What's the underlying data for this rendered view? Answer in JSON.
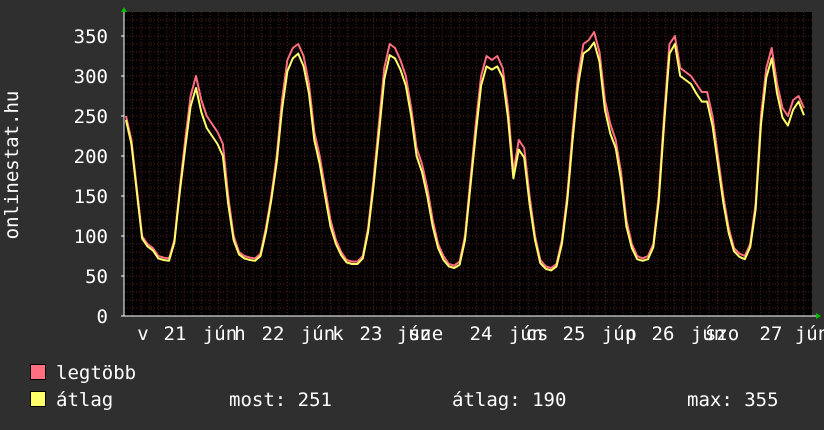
{
  "colors": {
    "background": "#2f2f2f",
    "plot_background": "#000000",
    "grid": "#5a1e1e",
    "axis": "#ffffff",
    "max_series": "#ff6f7f",
    "avg_series": "#ffff6a"
  },
  "legend": {
    "max_label": "legtöbb",
    "avg_label": "átlag"
  },
  "stats": {
    "current": "most: 251",
    "average": "átlag: 190",
    "maximum": "max: 355"
  },
  "chart_data": {
    "type": "line",
    "ylabel": "onlinestat.hu",
    "ylim": [
      0,
      380
    ],
    "yticks": [
      0,
      50,
      100,
      150,
      200,
      250,
      300,
      350
    ],
    "x_tick_labels": [
      "v",
      "21",
      "jún",
      "h",
      "22",
      "jún",
      "k",
      "23",
      "jún",
      "sze",
      "24",
      "jún",
      "cs",
      "25",
      "jún",
      "p",
      "26",
      "jún",
      "szo",
      "27",
      "jún"
    ],
    "grid": true,
    "series": [
      {
        "name": "legtöbb",
        "color": "#ff6f7f",
        "values": [
          250,
          220,
          160,
          100,
          90,
          85,
          75,
          73,
          72,
          95,
          160,
          220,
          275,
          300,
          270,
          250,
          240,
          230,
          215,
          150,
          100,
          80,
          75,
          73,
          72,
          78,
          110,
          150,
          200,
          270,
          320,
          335,
          340,
          325,
          290,
          230,
          200,
          160,
          120,
          95,
          80,
          70,
          68,
          68,
          75,
          110,
          170,
          240,
          310,
          340,
          335,
          320,
          300,
          260,
          210,
          190,
          160,
          120,
          90,
          75,
          65,
          63,
          68,
          100,
          170,
          240,
          300,
          325,
          320,
          325,
          310,
          260,
          180,
          220,
          210,
          150,
          100,
          70,
          62,
          60,
          65,
          95,
          150,
          230,
          300,
          340,
          345,
          355,
          330,
          270,
          240,
          220,
          180,
          120,
          90,
          75,
          72,
          75,
          90,
          150,
          250,
          340,
          350,
          310,
          305,
          300,
          290,
          280,
          280,
          250,
          200,
          150,
          110,
          85,
          78,
          75,
          90,
          140,
          250,
          310,
          335,
          290,
          260,
          250,
          270,
          275,
          260
        ]
      },
      {
        "name": "átlag",
        "color": "#ffff6a",
        "values": [
          245,
          215,
          155,
          97,
          87,
          82,
          72,
          70,
          69,
          92,
          155,
          210,
          262,
          285,
          255,
          235,
          225,
          215,
          200,
          140,
          95,
          77,
          72,
          70,
          69,
          75,
          105,
          145,
          192,
          258,
          306,
          322,
          328,
          312,
          278,
          220,
          190,
          150,
          112,
          90,
          76,
          67,
          65,
          65,
          72,
          105,
          162,
          228,
          296,
          326,
          322,
          308,
          288,
          250,
          200,
          180,
          150,
          112,
          85,
          70,
          62,
          60,
          64,
          95,
          162,
          228,
          288,
          312,
          308,
          312,
          298,
          248,
          172,
          208,
          198,
          140,
          95,
          66,
          59,
          57,
          62,
          90,
          143,
          220,
          288,
          328,
          333,
          342,
          318,
          258,
          228,
          210,
          170,
          112,
          85,
          71,
          69,
          71,
          86,
          143,
          240,
          328,
          340,
          300,
          295,
          290,
          278,
          268,
          268,
          238,
          190,
          142,
          104,
          81,
          74,
          71,
          86,
          133,
          240,
          298,
          322,
          278,
          248,
          238,
          258,
          268,
          251
        ]
      }
    ]
  }
}
